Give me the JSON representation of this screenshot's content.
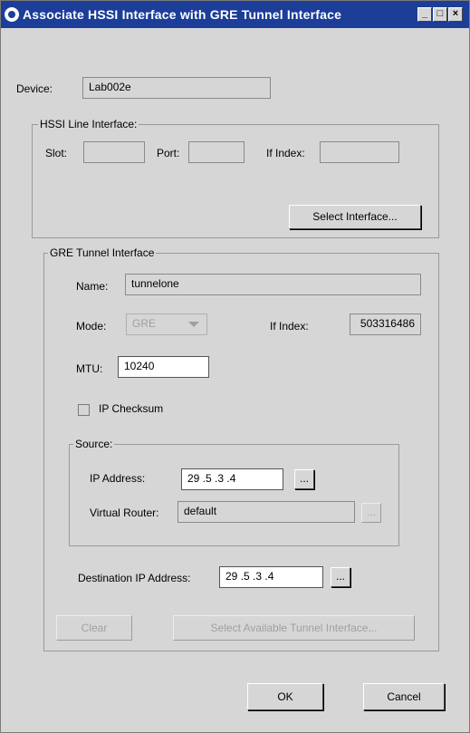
{
  "window": {
    "title": "Associate HSSI Interface with GRE Tunnel Interface",
    "minimize_glyph": "_",
    "maximize_glyph": "□",
    "close_glyph": "×"
  },
  "device": {
    "label": "Device:",
    "value": "Lab002e"
  },
  "hssi": {
    "legend": "HSSI Line Interface:",
    "slot_label": "Slot:",
    "slot_value": "",
    "port_label": "Port:",
    "port_value": "",
    "ifindex_label": "If Index:",
    "ifindex_value": "",
    "select_button": "Select Interface..."
  },
  "gre": {
    "legend": "GRE Tunnel Interface",
    "name_label": "Name:",
    "name_value": "tunnelone",
    "mode_label": "Mode:",
    "mode_value": "GRE",
    "ifindex_label": "If Index:",
    "ifindex_value": "503316486",
    "mtu_label": "MTU:",
    "mtu_value": "10240",
    "checksum_label": "IP Checksum",
    "checksum_checked": false,
    "source": {
      "legend": "Source:",
      "ip_label": "IP Address:",
      "ip_value": "29 .5  .3  .4",
      "browse_label": "...",
      "vr_label": "Virtual Router:",
      "vr_value": "default",
      "vr_browse_label": "..."
    },
    "dest_label": "Destination IP Address:",
    "dest_value": "29 .5  .3  .4",
    "dest_browse_label": "...",
    "clear_button": "Clear",
    "select_tunnel_button": "Select Available Tunnel Interface..."
  },
  "footer": {
    "ok_button": "OK",
    "cancel_button": "Cancel"
  },
  "colors": {
    "titlebar": "#1c3e98",
    "panel": "#d6d6d6"
  }
}
